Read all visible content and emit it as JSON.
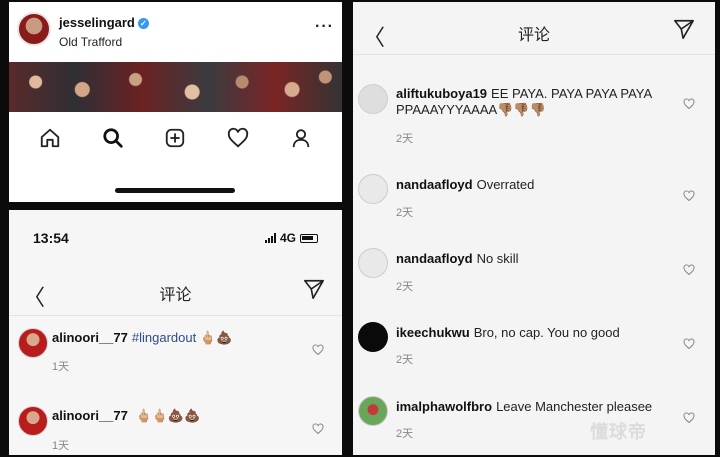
{
  "profile": {
    "username": "jesselingard",
    "location": "Old Trafford",
    "more_label": "···"
  },
  "nav_icons": [
    "home-icon",
    "search-icon",
    "new-post-icon",
    "activity-heart-icon",
    "profile-icon"
  ],
  "status_bar": {
    "time": "13:54",
    "network": "4G"
  },
  "comments_header": {
    "back_label": "〈",
    "title": "评论"
  },
  "left_comments": [
    {
      "user": "alinoori__77",
      "tag": "#lingardout",
      "text": "🖕🏼💩",
      "time": "1天"
    },
    {
      "user": "alinoori__77",
      "tag": "",
      "text": "🖕🏼🖕🏼💩💩",
      "time": "1天"
    }
  ],
  "right_comments": [
    {
      "user": "aliftukuboya19",
      "text": "EE PAYA. PAYA PAYA PAYA PPAAAYYYAAAA👎🏽👎🏽👎🏽",
      "time": "2天"
    },
    {
      "user": "nandaafloyd",
      "text": "Overrated",
      "time": "2天"
    },
    {
      "user": "nandaafloyd",
      "text": "No skill",
      "time": "2天"
    },
    {
      "user": "ikeechukwu",
      "text": "Bro, no cap. You no good",
      "time": "2天"
    },
    {
      "user": "imalphawolfbro",
      "text": "Leave Manchester pleasee",
      "time": "2天"
    }
  ],
  "watermark": "懂球帝",
  "colors": {
    "verified": "#3897f0",
    "hashtag": "#2b4d8a",
    "timestamp": "#888888"
  }
}
